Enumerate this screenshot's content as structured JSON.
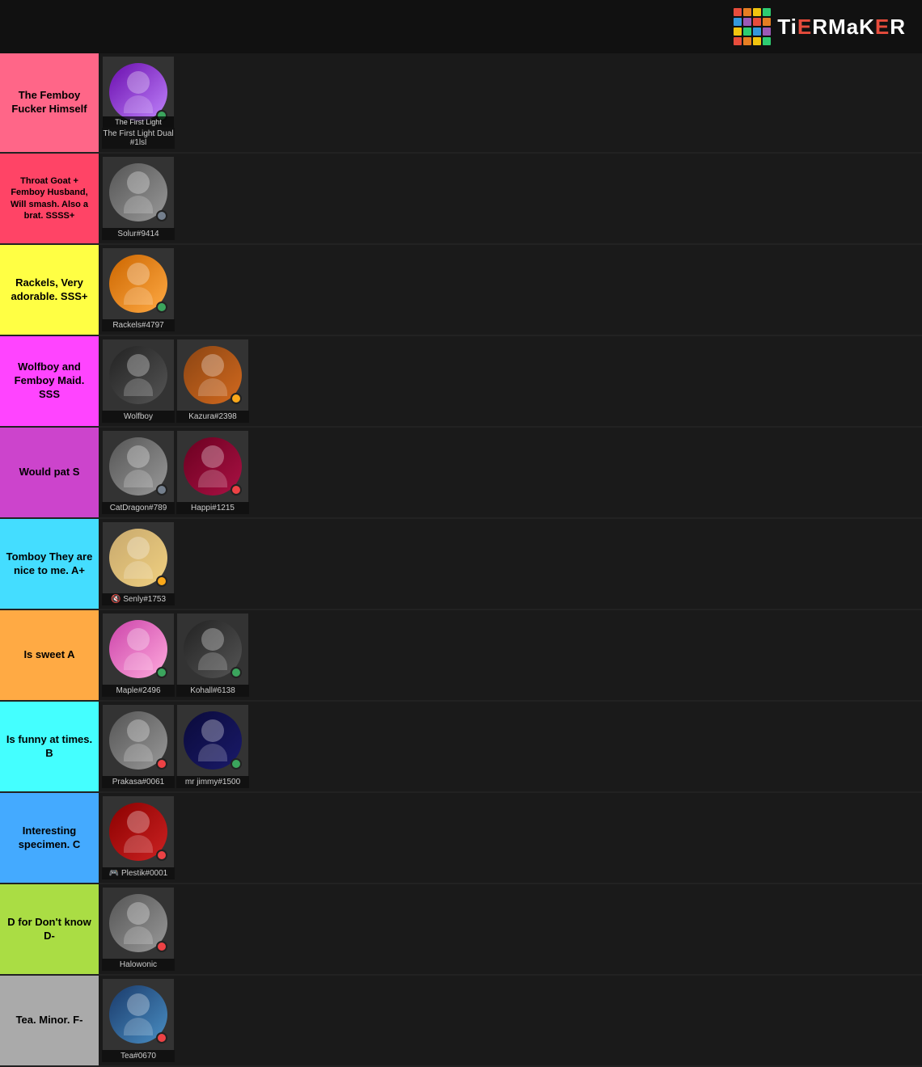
{
  "header": {
    "logo_text": "TiERMaKeR"
  },
  "logo_colors": [
    "#e74c3c",
    "#e67e22",
    "#f1c40f",
    "#2ecc71",
    "#3498db",
    "#9b59b6",
    "#e74c3c",
    "#e67e22",
    "#f1c40f",
    "#2ecc71",
    "#3498db",
    "#9b59b6",
    "#e74c3c",
    "#e67e22",
    "#f1c40f",
    "#2ecc71"
  ],
  "tiers": [
    {
      "id": "top",
      "label": "The Femboy Fucker Himself",
      "label_color": "#ff6688",
      "items": [
        {
          "name": "The First Light\nDual#1lsl",
          "avatar_class": "av-purple",
          "dot": "dot-green",
          "has_second": true
        }
      ]
    },
    {
      "id": "ssss_plus",
      "label": "Throat Goat + Femboy Husband, Will smash. Also a brat. SSSS+",
      "label_color": "#ff4466",
      "items": [
        {
          "name": "Solur#9414",
          "avatar_class": "av-gray",
          "dot": "dot-gray"
        }
      ]
    },
    {
      "id": "sss_plus",
      "label": "Rackels, Very adorable. SSS+",
      "label_color": "#ffff44",
      "items": [
        {
          "name": "Rackels#4797",
          "avatar_class": "av-orange",
          "dot": "dot-green"
        }
      ]
    },
    {
      "id": "sss",
      "label": "Wolfboy and Femboy Maid. SSS",
      "label_color": "#ff44ff",
      "items": [
        {
          "name": "Wolfboy",
          "avatar_class": "av-dark",
          "dot": null
        },
        {
          "name": "Kazura#2398",
          "avatar_class": "av-brown",
          "dot": "dot-yellow"
        }
      ]
    },
    {
      "id": "s",
      "label": "Would pat\nS",
      "label_color": "#cc44cc",
      "items": [
        {
          "name": "CatDragon#789",
          "avatar_class": "av-gray",
          "dot": "dot-gray"
        },
        {
          "name": "Happi#1215",
          "avatar_class": "av-wine",
          "dot": "dot-red"
        }
      ]
    },
    {
      "id": "a_plus",
      "label": "Tomboy They are nice to me. A+",
      "label_color": "#44ddff",
      "items": [
        {
          "name": "🔇 Senly#1753",
          "avatar_class": "av-cream",
          "dot": "dot-yellow"
        }
      ]
    },
    {
      "id": "a",
      "label": "Is sweet\nA",
      "label_color": "#ffaa44",
      "items": [
        {
          "name": "Maple#2496",
          "avatar_class": "av-pink",
          "dot": "dot-green"
        },
        {
          "name": "Kohall#6138",
          "avatar_class": "av-dark",
          "dot": "dot-green"
        }
      ]
    },
    {
      "id": "b",
      "label": "Is funny at times. B",
      "label_color": "#44ffff",
      "items": [
        {
          "name": "Prakasa#0061",
          "avatar_class": "av-gray",
          "dot": "dot-red"
        },
        {
          "name": "mr jimmy#1500",
          "avatar_class": "av-darkblue",
          "dot": "dot-green"
        }
      ]
    },
    {
      "id": "c",
      "label": "Interesting specimen. C",
      "label_color": "#44aaff",
      "items": [
        {
          "name": "🎮 Plestik#0001",
          "avatar_class": "av-red",
          "dot": "dot-red"
        }
      ]
    },
    {
      "id": "d_minus",
      "label": "D for Don't know\nD-",
      "label_color": "#aadd44",
      "items": [
        {
          "name": "Halowonic",
          "avatar_class": "av-gray",
          "dot": "dot-red"
        }
      ]
    },
    {
      "id": "f_minus",
      "label": "Tea. Minor.\nF-",
      "label_color": "#aaaaaa",
      "items": [
        {
          "name": "Tea#0670",
          "avatar_class": "av-blue",
          "dot": "dot-red"
        }
      ]
    }
  ]
}
